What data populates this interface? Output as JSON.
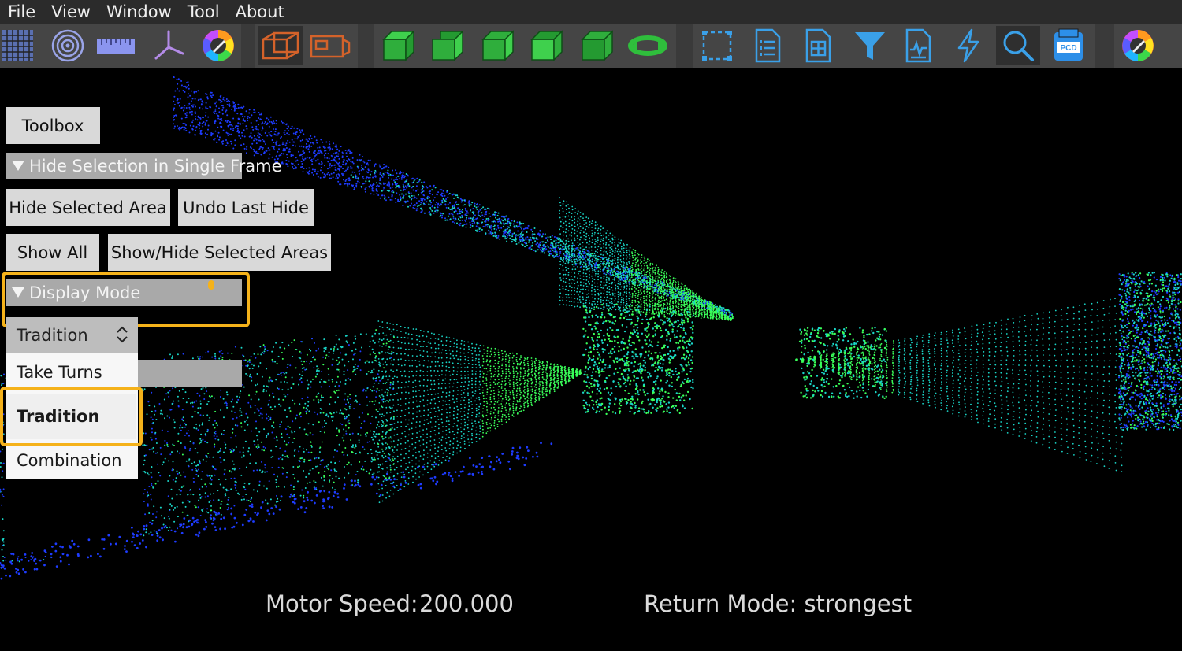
{
  "menu": {
    "items": [
      "File",
      "View",
      "Window",
      "Tool",
      "About"
    ]
  },
  "toolbar": {
    "buttons": [
      {
        "icon": "grid-icon"
      },
      {
        "icon": "concentric-rings-icon"
      },
      {
        "icon": "ruler-icon"
      },
      {
        "icon": "axes-icon"
      },
      {
        "icon": "color-wheel-icon"
      },
      {
        "icon": "box-orange-icon"
      },
      {
        "icon": "box-side-orange-icon"
      },
      {
        "icon": "cube-view-1-icon"
      },
      {
        "icon": "cube-view-2-icon"
      },
      {
        "icon": "cube-view-3-icon"
      },
      {
        "icon": "cube-view-4-icon"
      },
      {
        "icon": "cube-view-5-icon"
      },
      {
        "icon": "rotate-icon"
      },
      {
        "icon": "selection-box-icon"
      },
      {
        "icon": "document-list-icon"
      },
      {
        "icon": "document-grid-icon"
      },
      {
        "icon": "filter-icon"
      },
      {
        "icon": "document-chart-icon"
      },
      {
        "icon": "lightning-icon"
      },
      {
        "icon": "search-icon"
      },
      {
        "icon": "pcd-icon",
        "label": "PCD"
      },
      {
        "icon": "color-picker-icon"
      }
    ]
  },
  "panel": {
    "toolbox_label": "Toolbox",
    "hide_section_title": "Hide Selection in Single Frame",
    "hide_selected_area_label": "Hide Selected Area",
    "undo_last_hide_label": "Undo Last Hide",
    "show_all_label": "Show All",
    "show_hide_selected_label": "Show/Hide Selected Areas",
    "display_mode_title": "Display Mode",
    "display_mode_current": "Tradition",
    "display_mode_options": [
      "Take Turns",
      "Tradition",
      "Combination"
    ],
    "display_mode_selected_index": 1
  },
  "status": {
    "motor_speed_label": "Motor Speed:",
    "motor_speed_value": "200.000",
    "return_mode_text": "Return Mode: strongest"
  },
  "colors": {
    "highlight": "#f5b21a",
    "cloud_blue": "#1e3cff",
    "cloud_cyan": "#1ad6c8",
    "cloud_green": "#3aff5a",
    "cube_green": "#2fae3c"
  }
}
